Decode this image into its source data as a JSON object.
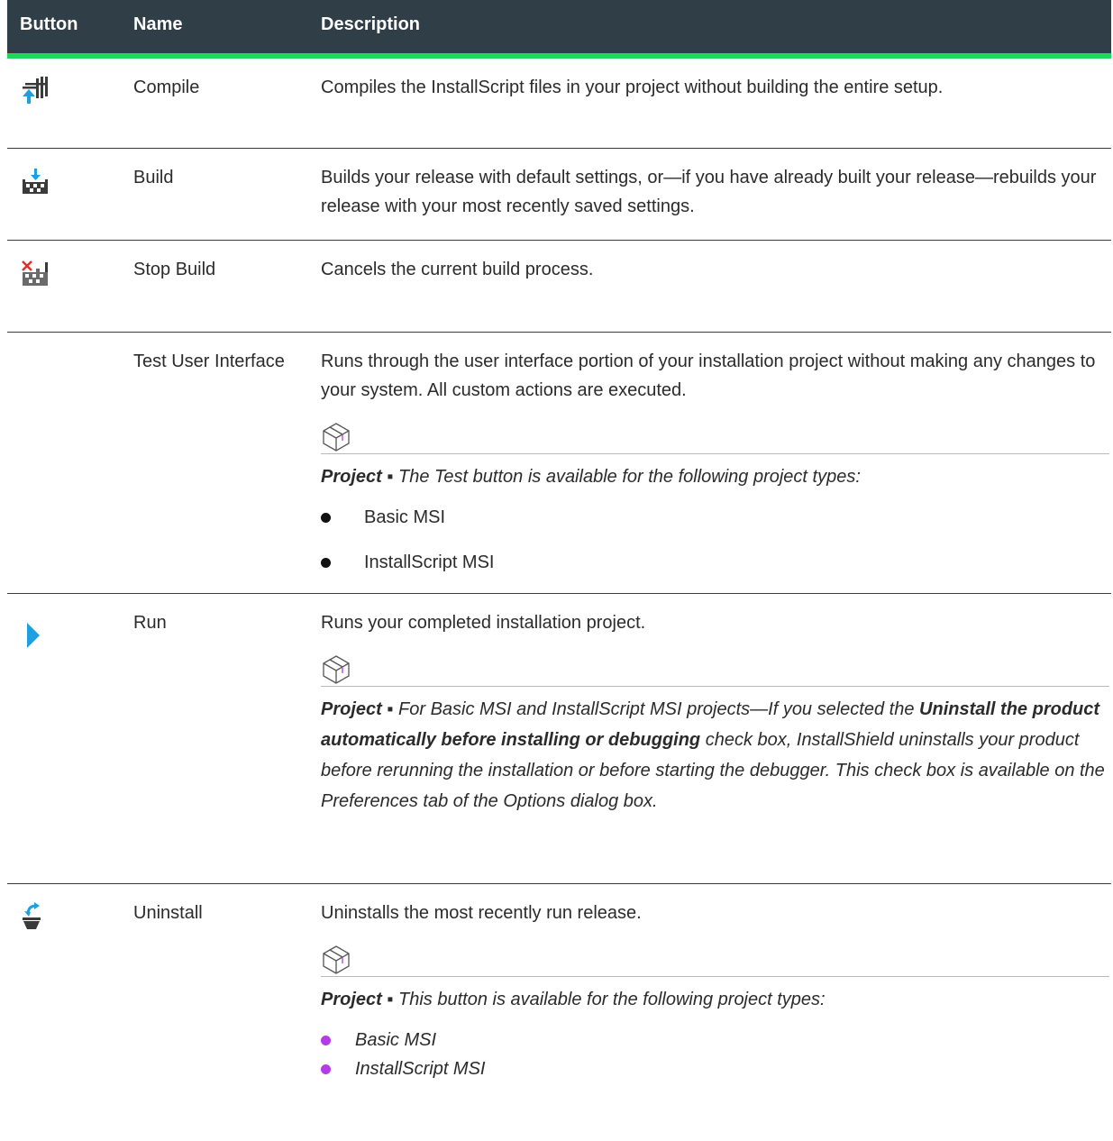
{
  "header": {
    "col_button": "Button",
    "col_name": "Name",
    "col_description": "Description"
  },
  "rows": [
    {
      "icon": "compile-icon",
      "name": "Compile",
      "description": "Compiles the InstallScript files in your project without building the entire setup."
    },
    {
      "icon": "build-icon",
      "name": "Build",
      "description": "Builds your release with default settings, or—if you have already built your release—rebuilds your release with your most recently saved settings."
    },
    {
      "icon": "stop-build-icon",
      "name": "Stop Build",
      "description": "Cancels the current build process."
    },
    {
      "icon": "",
      "name": "Test User Interface",
      "description": "Runs through the user interface portion of your installation project without making any changes to your system. All custom actions are executed.",
      "note": {
        "label": "Project ▪",
        "text": "The Test button is available for the following project types:"
      },
      "list": [
        "Basic MSI",
        "InstallScript MSI"
      ]
    },
    {
      "icon": "run-icon",
      "name": "Run",
      "description": "Runs your completed installation project.",
      "note": {
        "label": "Project ▪",
        "text_before": "For Basic MSI and InstallScript MSI projects—If you selected the",
        "bold": "Uninstall the product automatically before installing or debugging",
        "text_after": "check box, InstallShield uninstalls your product before rerunning the installation or before starting the debugger. This check box is available on the Preferences tab of the Options dialog box."
      }
    },
    {
      "icon": "uninstall-icon",
      "name": "Uninstall",
      "description": "Uninstalls the most recently run release.",
      "note": {
        "label": "Project ▪",
        "text": "This button is available for the following project types:"
      },
      "list": [
        "Basic MSI",
        "InstallScript MSI"
      ]
    }
  ],
  "colors": {
    "header_bg": "#303e48",
    "header_rule": "#1fd85a",
    "bullet_purple": "#b43ce6",
    "icon_blue": "#1e9fe0"
  }
}
